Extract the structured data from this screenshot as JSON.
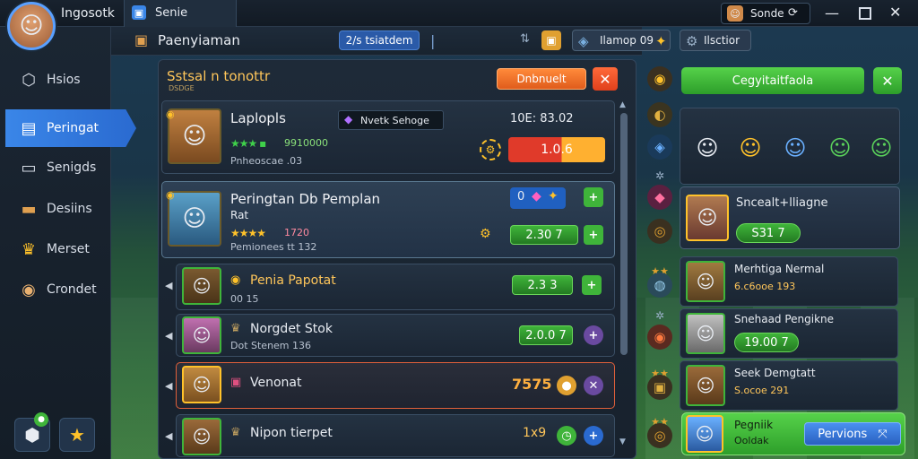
{
  "app": {
    "title": "Ingosotk",
    "tab": "Senie"
  },
  "topbar": {
    "currency": "Sonde"
  },
  "header": {
    "title": "Paenyiaman",
    "search": "2/s tsiatdem",
    "gold_pill": "Ilamop 09",
    "settings": "Ilsctior"
  },
  "sidebar": {
    "items": [
      {
        "label": "Hsios",
        "icon": "shield-icon"
      },
      {
        "label": "Peringat",
        "icon": "chat-icon"
      },
      {
        "label": "Senigds",
        "icon": "monitor-icon"
      },
      {
        "label": "Desiins",
        "icon": "folder-icon"
      },
      {
        "label": "Merset",
        "icon": "crown-icon"
      },
      {
        "label": "Crondet",
        "icon": "helmet-icon"
      }
    ]
  },
  "main": {
    "title": "Sstsal n tonottr",
    "subtitle": "DSDGE",
    "action_button": "Dnbnuelt",
    "rows": [
      {
        "name": "Laplopls",
        "tag": "Nvetk Sehoge",
        "rating": "9910000",
        "sub": "Pnheoscae .03",
        "stat": "10E: 83.02",
        "value": "1.0.6"
      },
      {
        "name": "Peringtan Db Pemplan",
        "name2": "Rat",
        "rating": "1720",
        "sub": "Pemionees tt 132",
        "value": "2.30   7",
        "chip": "0"
      },
      {
        "name": "Penia Papotat",
        "sub": "00          15",
        "value": "2.3     3"
      },
      {
        "name": "Norgdet Stok",
        "sub": "Dot Stenem 136",
        "value": "2.0.0   7"
      },
      {
        "name": "Venonat",
        "value": "7575"
      },
      {
        "name": "Nipon tierpet",
        "value": "1x9"
      }
    ]
  },
  "right": {
    "header_button": "Cegyitaitfaola",
    "featured": {
      "name": "Sncealt+lliagne",
      "value": "S31   7"
    },
    "cards": [
      {
        "name": "Merhtiga Nermal",
        "sub": "6.c6ooe 193"
      },
      {
        "name": "Snehaad Pengikne",
        "sub": "19.00   7"
      },
      {
        "name": "Seek Demgtatt",
        "sub": "S.ocoe 291"
      }
    ],
    "bottom": {
      "name": "Pegniik",
      "sub": "Ooldak",
      "button": "Pervions"
    }
  },
  "colors": {
    "accent_blue": "#3a86e8",
    "accent_green": "#3fb43a",
    "accent_orange": "#ff6a3a"
  }
}
